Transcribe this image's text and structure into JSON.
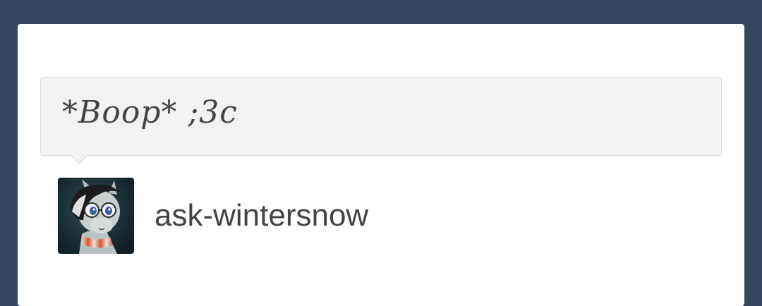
{
  "post": {
    "bubble_text": "*Boop* ;3c",
    "username": "ask-wintersnow"
  },
  "colors": {
    "page_background": "#36465d",
    "card_background": "#ffffff",
    "bubble_background": "#f2f2f2",
    "text": "#444444"
  },
  "icons": {
    "avatar": "pony-avatar"
  }
}
